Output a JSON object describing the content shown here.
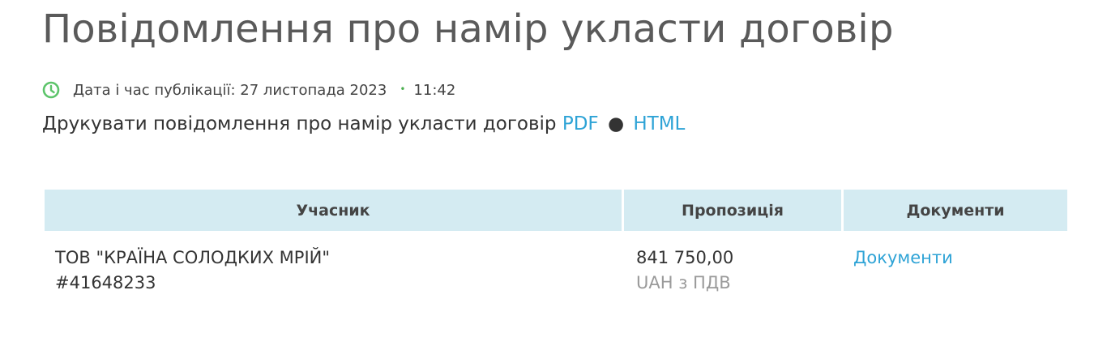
{
  "page": {
    "title": "Повідомлення про намір укласти договір"
  },
  "publication": {
    "icon": "clock-icon",
    "label": "Дата і час публікації: 27 листопада 2023",
    "time": "11:42",
    "separator": "•"
  },
  "print": {
    "text": "Друкувати повідомлення про намір укласти договір",
    "pdf_label": "PDF",
    "separator": "●",
    "html_label": "HTML"
  },
  "table": {
    "headers": [
      "Учасник",
      "Пропозиція",
      "Документи"
    ],
    "rows": [
      {
        "participant_name": "ТОВ \"КРАЇНА СОЛОДКИХ МРІЙ\"",
        "participant_code": "#41648233",
        "amount": "841 750,00",
        "currency": "UAH з ПДВ",
        "documents_link": "Документи"
      }
    ]
  },
  "colors": {
    "link": "#2ea3d6",
    "header_bg": "#d4ebf2",
    "clock": "#4caf50"
  }
}
